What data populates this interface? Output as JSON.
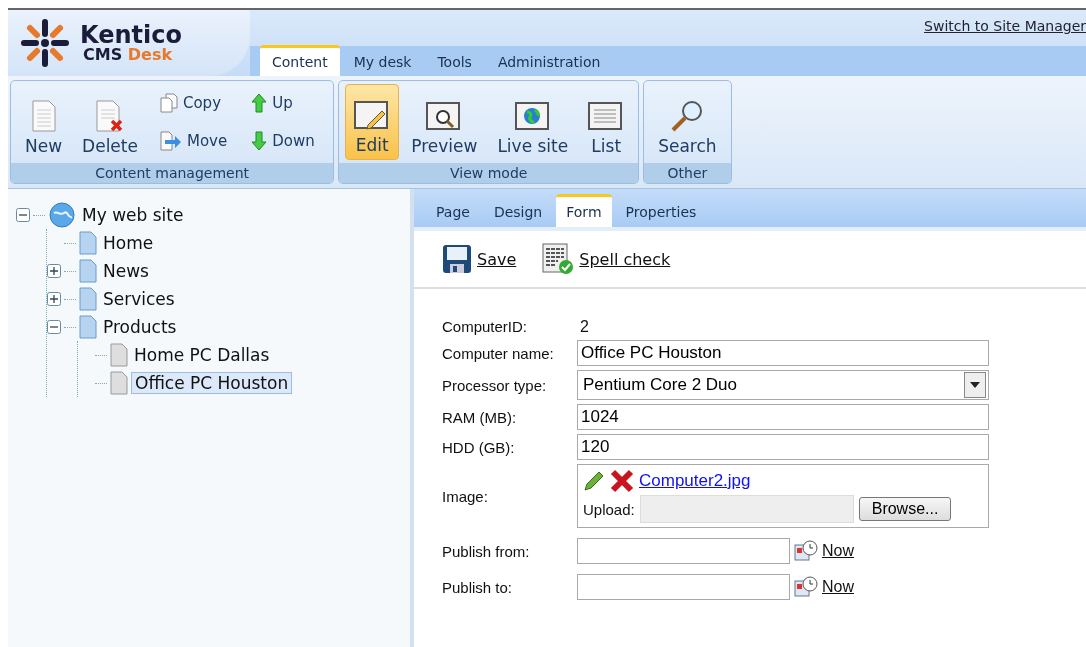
{
  "header": {
    "logo": {
      "name": "Kentico",
      "product": "CMS",
      "edition": "Desk"
    },
    "switch_link": "Switch to Site Manager",
    "tabs": [
      {
        "label": "Content",
        "selected": true
      },
      {
        "label": "My desk",
        "selected": false
      },
      {
        "label": "Tools",
        "selected": false
      },
      {
        "label": "Administration",
        "selected": false
      }
    ]
  },
  "ribbon": [
    {
      "title": "Content management",
      "items": [
        {
          "label": "New",
          "kind": "large",
          "selected": false
        },
        {
          "label": "Delete",
          "kind": "large",
          "selected": false
        },
        {
          "kind": "stack",
          "items": [
            {
              "label": "Copy"
            },
            {
              "label": "Move"
            }
          ]
        },
        {
          "kind": "stack",
          "items": [
            {
              "label": "Up"
            },
            {
              "label": "Down"
            }
          ]
        }
      ]
    },
    {
      "title": "View mode",
      "items": [
        {
          "label": "Edit",
          "kind": "large",
          "selected": true
        },
        {
          "label": "Preview",
          "kind": "large",
          "selected": false
        },
        {
          "label": "Live site",
          "kind": "large",
          "selected": false
        },
        {
          "label": "List",
          "kind": "large",
          "selected": false
        }
      ]
    },
    {
      "title": "Other",
      "items": [
        {
          "label": "Search",
          "kind": "large",
          "selected": false
        }
      ]
    }
  ],
  "tree": [
    {
      "label": "My web site",
      "kind": "site",
      "expanded": true,
      "selected": false,
      "children": [
        {
          "label": "Home",
          "kind": "page",
          "selected": false
        },
        {
          "label": "News",
          "kind": "page",
          "expanded": false,
          "selected": false
        },
        {
          "label": "Services",
          "kind": "page",
          "expanded": false,
          "selected": false
        },
        {
          "label": "Products",
          "kind": "page",
          "expanded": true,
          "selected": false,
          "children": [
            {
              "label": "Home PC Dallas",
              "kind": "item",
              "selected": false
            },
            {
              "label": "Office PC Houston",
              "kind": "item",
              "selected": true
            }
          ]
        }
      ]
    }
  ],
  "page_tabs": [
    {
      "label": "Page",
      "selected": false
    },
    {
      "label": "Design",
      "selected": false
    },
    {
      "label": "Form",
      "selected": true
    },
    {
      "label": "Properties",
      "selected": false
    }
  ],
  "actions": [
    {
      "label": "Save"
    },
    {
      "label": "Spell check"
    }
  ],
  "form": [
    {
      "label": "ComputerID:",
      "kind": "static",
      "value": "2"
    },
    {
      "label": "Computer name:",
      "kind": "text",
      "value": "Office PC Houston"
    },
    {
      "label": "Processor type:",
      "kind": "select",
      "value": "Pentium Core 2 Duo"
    },
    {
      "label": "RAM (MB):",
      "kind": "text",
      "value": "1024"
    },
    {
      "label": "HDD (GB):",
      "kind": "text",
      "value": "120"
    },
    {
      "label": "Image:",
      "kind": "image",
      "file": "Computer2.jpg",
      "upload_label": "Upload:",
      "browse": "Browse..."
    },
    {
      "label": "Publish from:",
      "kind": "date",
      "now": "Now"
    },
    {
      "label": "Publish to:",
      "kind": "date",
      "now": "Now"
    }
  ]
}
